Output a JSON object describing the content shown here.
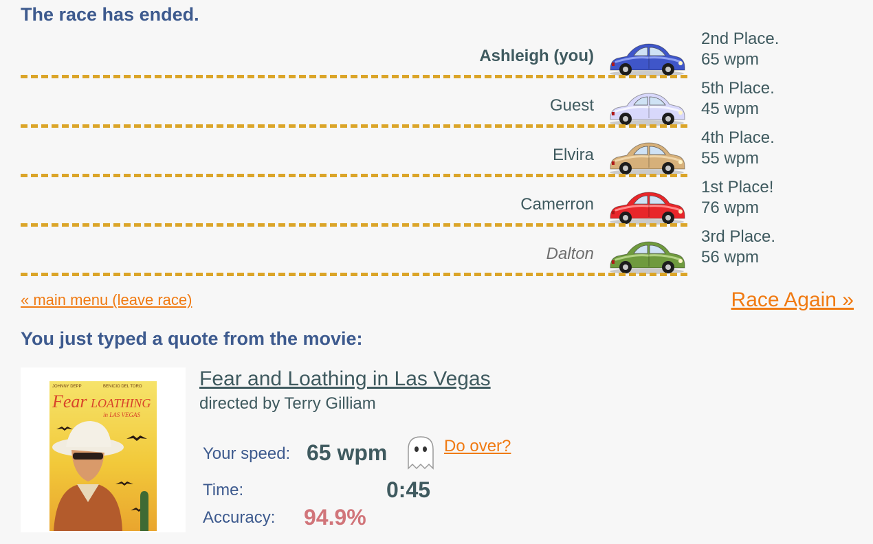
{
  "race": {
    "heading": "The race has ended.",
    "lanes": [
      {
        "name": "Ashleigh (you)",
        "place": "2nd Place.",
        "speed": "65 wpm",
        "car_color": "#3f56c9",
        "car_light": "#8ea0f2"
      },
      {
        "name": "Guest",
        "place": "5th Place.",
        "speed": "45 wpm",
        "car_color": "#d8d8fb",
        "car_light": "#f4f4ff"
      },
      {
        "name": "Elvira",
        "place": "4th Place.",
        "speed": "55 wpm",
        "car_color": "#d6b07a",
        "car_light": "#f0d6aa"
      },
      {
        "name": "Camerron",
        "place": "1st Place!",
        "speed": "76 wpm",
        "car_color": "#e8262a",
        "car_light": "#ff8a8a"
      },
      {
        "name": "Dalton",
        "place": "3rd Place.",
        "speed": "56 wpm",
        "car_color": "#6f9a3e",
        "car_light": "#b3d284"
      }
    ],
    "lane_divider_color": "#dba529"
  },
  "nav": {
    "main_menu": "« main menu (leave race)",
    "race_again": "Race Again »"
  },
  "quote": {
    "heading": "You just typed a quote from the movie:",
    "movie_title": "Fear and Loathing in Las Vegas",
    "directed_by": "directed by",
    "director": "Terry Gilliam",
    "poster_title_line1": "Fear",
    "poster_title_line2": "LOATHING",
    "poster_title_line3": "in LAS VEGAS",
    "poster_actor_left": "JOHNNY DEPP",
    "poster_actor_right": "BENICIO DEL TORO"
  },
  "stats": {
    "speed_label": "Your speed:",
    "speed_value": "65 wpm",
    "do_over": "Do over?",
    "time_label": "Time:",
    "time_value": "0:45",
    "accuracy_label": "Accuracy:",
    "accuracy_value": "94.9%"
  },
  "colors": {
    "heading": "#3d5a8e",
    "link": "#f07a12",
    "text": "#3f5a5f",
    "accuracy": "#d1757a"
  }
}
